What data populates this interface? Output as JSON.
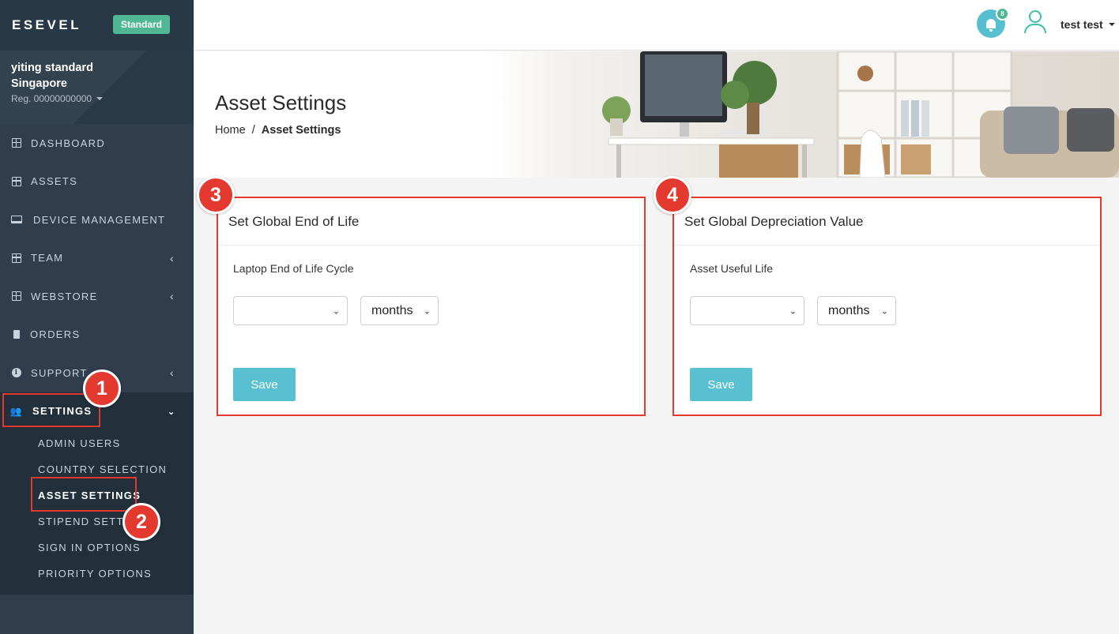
{
  "brand": {
    "logo": "ESEVEL",
    "plan": "Standard"
  },
  "company": {
    "name_line1": "yiting standard",
    "name_line2": "Singapore",
    "reg": "Reg. 00000000000"
  },
  "nav": {
    "dashboard": "DASHBOARD",
    "assets": "ASSETS",
    "device_management": "DEVICE MANAGEMENT",
    "team": "TEAM",
    "webstore": "WEBSTORE",
    "orders": "ORDERS",
    "support": "SUPPORT",
    "settings": "SETTINGS",
    "sub": {
      "admin_users": "ADMIN USERS",
      "country_selection": "COUNTRY SELECTION",
      "asset_settings": "ASSET SETTINGS",
      "stipend_settings": "STIPEND SETTI",
      "sign_in_options": "SIGN IN OPTIONS",
      "priority_options": "PRIORITY OPTIONS"
    }
  },
  "topbar": {
    "notification_count": "8",
    "user_name": "test test"
  },
  "page": {
    "title": "Asset Settings",
    "breadcrumb_home": "Home",
    "breadcrumb_sep": "/",
    "breadcrumb_current": "Asset Settings"
  },
  "cards": {
    "end_of_life": {
      "title": "Set Global End of Life",
      "field_label": "Laptop End of Life Cycle",
      "value": "",
      "unit": "months",
      "save_label": "Save"
    },
    "depreciation": {
      "title": "Set Global Depreciation Value",
      "field_label": "Asset Useful Life",
      "value": "",
      "unit": "months",
      "save_label": "Save"
    }
  },
  "markers": {
    "m1": "1",
    "m2": "2",
    "m3": "3",
    "m4": "4"
  },
  "colors": {
    "sidebar": "#2f3d4c",
    "accent": "#58c0d0",
    "badge": "#4fb893",
    "highlight": "#e3392e"
  }
}
